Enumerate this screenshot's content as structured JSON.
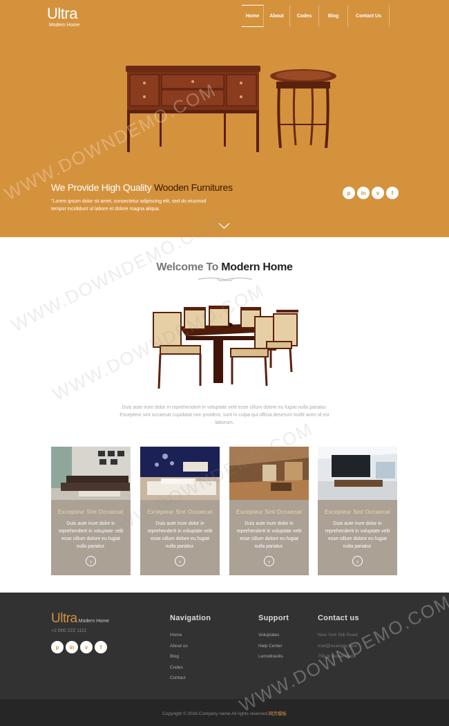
{
  "header": {
    "logo_title": "Ultra",
    "logo_sub": "Modern Home",
    "nav": [
      "Home",
      "About",
      "Codes",
      "Blog",
      "Contact Us"
    ]
  },
  "hero": {
    "title_light": "We Provide High Quality ",
    "title_dark": "Wooden Furnitures",
    "text": "\"Lorem ipsum dolor sit amet, consectetur adipiscing elit, sed do eiusmod tempor incididunt ut labore et dolore magna aliqua.",
    "social": [
      "p",
      "in",
      "v",
      "f"
    ]
  },
  "welcome": {
    "title_light": "Welcome To ",
    "title_dark": "Modern Home",
    "text": "Duis aute irure dolor in reprehenderit in voluptate velit esse cillum dolore eu fugiat nulla pariatur. Excepteur sint occaecat cupidatat non proident, sunt in culpa qui officia deserunt mollit anim id est laborum."
  },
  "cards": [
    {
      "title": "Excepteur Sint Occaecat",
      "text": "Duis aute irure dolor in reprehenderit in voluptate velit esse cillum dolore eu fugiat nulla pariatur."
    },
    {
      "title": "Excepteur Sint Occaecat",
      "text": "Duis aute irure dolor in reprehenderit in voluptate velit esse cillum dolore eu fugiat nulla pariatur."
    },
    {
      "title": "Excepteur Sint Occaecat",
      "text": "Duis aute irure dolor in reprehenderit in voluptate velit esse cillum dolore eu fugiat nulla pariatur."
    },
    {
      "title": "Excepteur Sint Occaecat",
      "text": "Duis aute irure dolor in reprehenderit in voluptate velit esse cillum dolore eu fugiat nulla pariatur."
    }
  ],
  "footer": {
    "logo_title": "Ultra",
    "logo_sub": "Modern Home",
    "phone": "+2 000 222 1111",
    "navigation_heading": "Navigation",
    "navigation": [
      "Home",
      "About us",
      "Blog",
      "Codes",
      "Contact"
    ],
    "support_heading": "Support",
    "support": [
      "Voluptates",
      "Help Center",
      "Lemollravilis"
    ],
    "contact_heading": "Contact us",
    "contact": [
      "New York Still Road.",
      "mail@example.com",
      "756 gt globel Place"
    ],
    "copyright": "Copyright © 2016.Company name All rights reserved.",
    "copyright_link": "网页模板"
  },
  "watermark": "WWW.DOWNDEMO.COM",
  "colors": {
    "accent": "#d5923d",
    "card": "#aba195",
    "footer": "#323232"
  }
}
